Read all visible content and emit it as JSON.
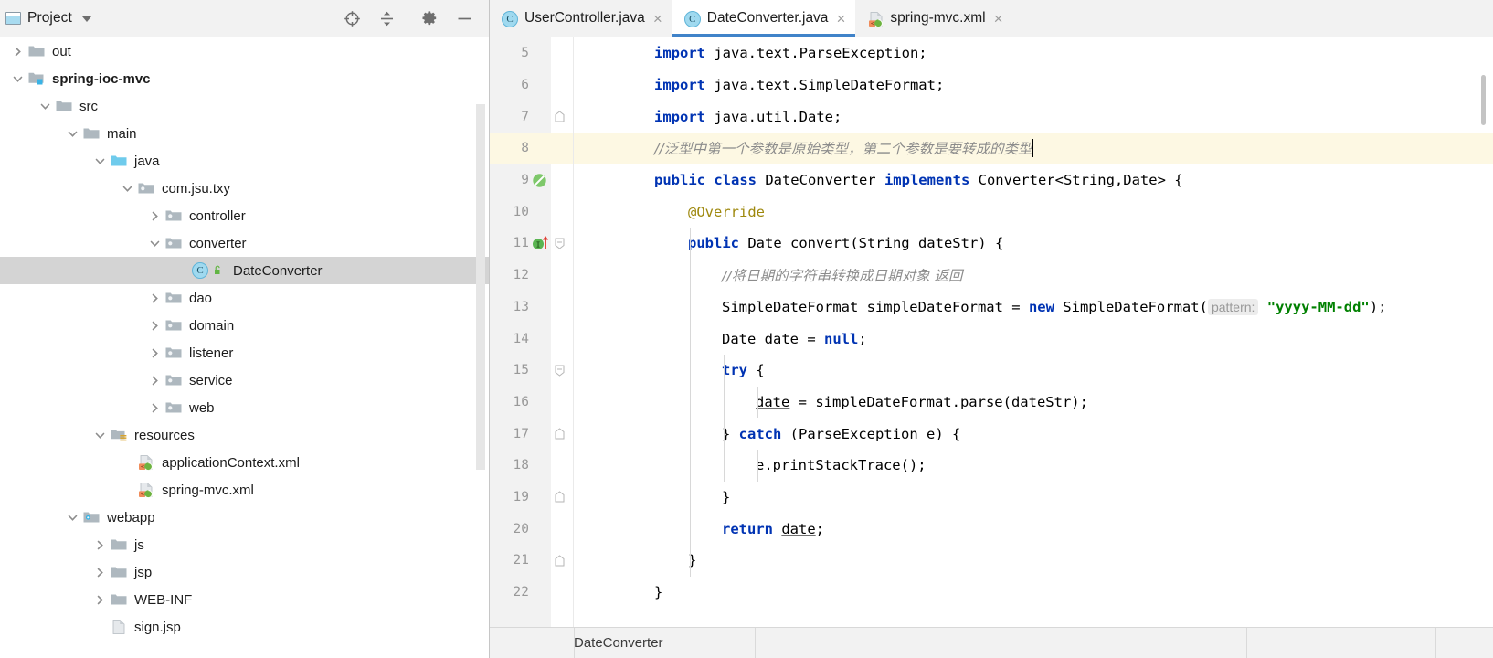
{
  "panel": {
    "title": "Project",
    "dropdown_icon": "chevron-down-icon",
    "tool_buttons": [
      {
        "name": "locate-icon",
        "label": "Select Opened File"
      },
      {
        "name": "collapse-all-icon",
        "label": "Collapse All"
      },
      {
        "name": "gear-icon",
        "label": "Settings"
      },
      {
        "name": "minimize-icon",
        "label": "Hide"
      }
    ]
  },
  "tree": [
    {
      "label": "out",
      "depth": 0,
      "twist": "collapsed",
      "icon": "folder",
      "bold": false,
      "selected": false
    },
    {
      "label": "spring-ioc-mvc",
      "depth": 0,
      "twist": "expanded",
      "icon": "module",
      "bold": true,
      "selected": false
    },
    {
      "label": "src",
      "depth": 1,
      "twist": "expanded",
      "icon": "folder",
      "bold": false,
      "selected": false
    },
    {
      "label": "main",
      "depth": 2,
      "twist": "expanded",
      "icon": "folder",
      "bold": false,
      "selected": false
    },
    {
      "label": "java",
      "depth": 3,
      "twist": "expanded",
      "icon": "source-folder",
      "bold": false,
      "selected": false
    },
    {
      "label": "com.jsu.txy",
      "depth": 4,
      "twist": "expanded",
      "icon": "package",
      "bold": false,
      "selected": false
    },
    {
      "label": "controller",
      "depth": 5,
      "twist": "collapsed",
      "icon": "package",
      "bold": false,
      "selected": false
    },
    {
      "label": "converter",
      "depth": 5,
      "twist": "expanded",
      "icon": "package",
      "bold": false,
      "selected": false
    },
    {
      "label": "DateConverter",
      "depth": 6,
      "twist": "none",
      "icon": "java-class",
      "bold": false,
      "selected": true
    },
    {
      "label": "dao",
      "depth": 5,
      "twist": "collapsed",
      "icon": "package",
      "bold": false,
      "selected": false
    },
    {
      "label": "domain",
      "depth": 5,
      "twist": "collapsed",
      "icon": "package",
      "bold": false,
      "selected": false
    },
    {
      "label": "listener",
      "depth": 5,
      "twist": "collapsed",
      "icon": "package",
      "bold": false,
      "selected": false
    },
    {
      "label": "service",
      "depth": 5,
      "twist": "collapsed",
      "icon": "package",
      "bold": false,
      "selected": false
    },
    {
      "label": "web",
      "depth": 5,
      "twist": "collapsed",
      "icon": "package",
      "bold": false,
      "selected": false
    },
    {
      "label": "resources",
      "depth": 3,
      "twist": "expanded",
      "icon": "resource-folder",
      "bold": false,
      "selected": false
    },
    {
      "label": "applicationContext.xml",
      "depth": 4,
      "twist": "none",
      "icon": "spring-xml",
      "bold": false,
      "selected": false
    },
    {
      "label": "spring-mvc.xml",
      "depth": 4,
      "twist": "none",
      "icon": "spring-xml",
      "bold": false,
      "selected": false
    },
    {
      "label": "webapp",
      "depth": 2,
      "twist": "expanded",
      "icon": "webapp-folder",
      "bold": false,
      "selected": false
    },
    {
      "label": "js",
      "depth": 3,
      "twist": "collapsed",
      "icon": "folder",
      "bold": false,
      "selected": false
    },
    {
      "label": "jsp",
      "depth": 3,
      "twist": "collapsed",
      "icon": "folder",
      "bold": false,
      "selected": false
    },
    {
      "label": "WEB-INF",
      "depth": 3,
      "twist": "collapsed",
      "icon": "folder",
      "bold": false,
      "selected": false
    },
    {
      "label": "sign.jsp",
      "depth": 3,
      "twist": "none",
      "icon": "jsp-file",
      "bold": false,
      "selected": false
    }
  ],
  "tabs": [
    {
      "label": "UserController.java",
      "icon": "java-class",
      "active": false,
      "close_icon": "close-icon"
    },
    {
      "label": "DateConverter.java",
      "icon": "java-class",
      "active": true,
      "close_icon": "close-icon"
    },
    {
      "label": "spring-mvc.xml",
      "icon": "spring-xml",
      "active": false,
      "close_icon": "close-icon"
    }
  ],
  "editor": {
    "first_line": 5,
    "highlighted_line": 8,
    "caret_line": 8,
    "lines": [
      {
        "num": 5,
        "indent": 0,
        "gutter_icon": "",
        "fold": "",
        "tokens": [
          {
            "t": "import",
            "c": "kw"
          },
          {
            "t": " java.text.ParseException;",
            "c": ""
          }
        ]
      },
      {
        "num": 6,
        "indent": 0,
        "gutter_icon": "",
        "fold": "",
        "tokens": [
          {
            "t": "import",
            "c": "kw"
          },
          {
            "t": " java.text.SimpleDateFormat;",
            "c": ""
          }
        ]
      },
      {
        "num": 7,
        "indent": 0,
        "gutter_icon": "",
        "fold": "fold-end",
        "tokens": [
          {
            "t": "import",
            "c": "kw"
          },
          {
            "t": " java.util.Date;",
            "c": ""
          }
        ]
      },
      {
        "num": 8,
        "indent": 0,
        "gutter_icon": "",
        "fold": "",
        "tokens": [
          {
            "t": "//泛型中第一个参数是原始类型，第二个参数是要转成的类型",
            "c": "cmt cjk"
          },
          {
            "t": "",
            "c": "caret"
          }
        ]
      },
      {
        "num": 9,
        "indent": 0,
        "gutter_icon": "bean-icon",
        "fold": "",
        "tokens": [
          {
            "t": "public class",
            "c": "kw"
          },
          {
            "t": " DateConverter ",
            "c": ""
          },
          {
            "t": "implements",
            "c": "kw"
          },
          {
            "t": " Converter<String,Date> {",
            "c": ""
          }
        ]
      },
      {
        "num": 10,
        "indent": 1,
        "gutter_icon": "",
        "fold": "",
        "tokens": [
          {
            "t": "@Override",
            "c": "anno"
          }
        ]
      },
      {
        "num": 11,
        "indent": 1,
        "gutter_icon": "implements-icon",
        "fold": "fold-open",
        "tokens": [
          {
            "t": "public",
            "c": "kw"
          },
          {
            "t": " Date convert(String dateStr) {",
            "c": ""
          }
        ]
      },
      {
        "num": 12,
        "indent": 2,
        "gutter_icon": "",
        "fold": "",
        "tokens": [
          {
            "t": "//将日期的字符串转换成日期对象 返回",
            "c": "cmt cjk"
          }
        ]
      },
      {
        "num": 13,
        "indent": 2,
        "gutter_icon": "",
        "fold": "",
        "tokens": [
          {
            "t": "SimpleDateFormat simpleDateFormat = ",
            "c": ""
          },
          {
            "t": "new",
            "c": "kw"
          },
          {
            "t": " SimpleDateFormat(",
            "c": ""
          },
          {
            "t": "pattern:",
            "c": "hint"
          },
          {
            "t": " ",
            "c": ""
          },
          {
            "t": "\"yyyy-MM-dd\"",
            "c": "str"
          },
          {
            "t": ");",
            "c": ""
          }
        ]
      },
      {
        "num": 14,
        "indent": 2,
        "gutter_icon": "",
        "fold": "",
        "tokens": [
          {
            "t": "Date ",
            "c": ""
          },
          {
            "t": "date",
            "c": "fld"
          },
          {
            "t": " = ",
            "c": ""
          },
          {
            "t": "null",
            "c": "kw"
          },
          {
            "t": ";",
            "c": ""
          }
        ]
      },
      {
        "num": 15,
        "indent": 2,
        "gutter_icon": "",
        "fold": "fold-open",
        "tokens": [
          {
            "t": "try",
            "c": "kw"
          },
          {
            "t": " {",
            "c": ""
          }
        ]
      },
      {
        "num": 16,
        "indent": 3,
        "gutter_icon": "",
        "fold": "",
        "tokens": [
          {
            "t": "date",
            "c": "fld"
          },
          {
            "t": " = simpleDateFormat.parse(dateStr);",
            "c": ""
          }
        ]
      },
      {
        "num": 17,
        "indent": 2,
        "gutter_icon": "",
        "fold": "fold-end",
        "tokens": [
          {
            "t": "} ",
            "c": ""
          },
          {
            "t": "catch",
            "c": "kw"
          },
          {
            "t": " (ParseException e) {",
            "c": ""
          }
        ]
      },
      {
        "num": 18,
        "indent": 3,
        "gutter_icon": "",
        "fold": "",
        "tokens": [
          {
            "t": "e.printStackTrace();",
            "c": ""
          }
        ]
      },
      {
        "num": 19,
        "indent": 2,
        "gutter_icon": "",
        "fold": "fold-end",
        "tokens": [
          {
            "t": "}",
            "c": ""
          }
        ]
      },
      {
        "num": 20,
        "indent": 2,
        "gutter_icon": "",
        "fold": "",
        "tokens": [
          {
            "t": "return",
            "c": "kw"
          },
          {
            "t": " ",
            "c": ""
          },
          {
            "t": "date",
            "c": "fld"
          },
          {
            "t": ";",
            "c": ""
          }
        ]
      },
      {
        "num": 21,
        "indent": 1,
        "gutter_icon": "",
        "fold": "fold-end",
        "tokens": [
          {
            "t": "}",
            "c": ""
          }
        ]
      },
      {
        "num": 22,
        "indent": 0,
        "gutter_icon": "",
        "fold": "",
        "tokens": [
          {
            "t": "}",
            "c": ""
          }
        ]
      }
    ]
  },
  "breadcrumb": {
    "text": "DateConverter"
  },
  "colors": {
    "keyword": "#0033b3",
    "string": "#008000",
    "comment": "#8c8c8c",
    "annotation": "#9e880d",
    "tab_underline": "#4083c9",
    "selection": "#d4d4d4",
    "caret_line": "#fdf8e3",
    "panel_bg": "#f2f2f2"
  }
}
